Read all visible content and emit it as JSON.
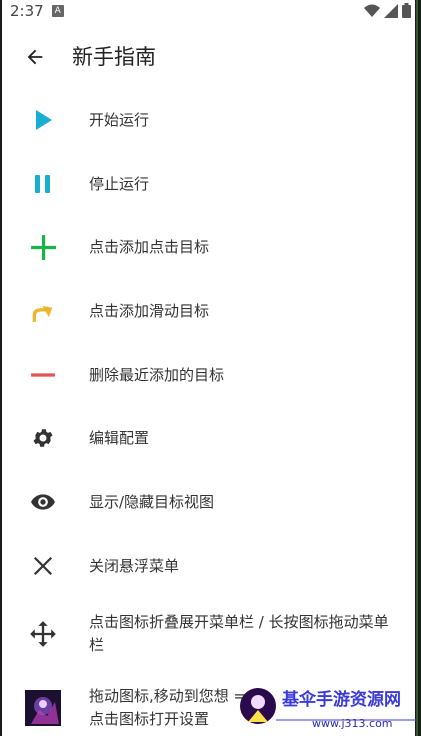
{
  "status_bar": {
    "time": "2:37",
    "badge": "A"
  },
  "header": {
    "title": "新手指南"
  },
  "items": [
    {
      "icon": "play-icon",
      "label": "开始运行",
      "color": "#1aafd0"
    },
    {
      "icon": "pause-icon",
      "label": "停止运行",
      "color": "#1aafd0"
    },
    {
      "icon": "plus-icon",
      "label": "点击添加点击目标",
      "color": "#19b34a"
    },
    {
      "icon": "swipe-arrow-icon",
      "label": "点击添加滑动目标",
      "color": "#f0b429"
    },
    {
      "icon": "minus-icon",
      "label": "删除最近添加的目标",
      "color": "#e05555"
    },
    {
      "icon": "gear-icon",
      "label": "编辑配置",
      "color": "#333333"
    },
    {
      "icon": "eye-icon",
      "label": "显示/隐藏目标视图",
      "color": "#333333"
    },
    {
      "icon": "close-icon",
      "label": "关闭悬浮菜单",
      "color": "#333333"
    },
    {
      "icon": "move-icon",
      "label": "点击图标折叠展开菜单栏 / 长按图标拖动菜单栏",
      "color": "#333333"
    },
    {
      "icon": "app-thumbnail-icon",
      "label": "拖动图标,移动到您想 =>点击图标打开设置",
      "color": "#333333"
    }
  ],
  "watermark": {
    "title": "基伞手游资源网",
    "url": "www.j313.com"
  }
}
